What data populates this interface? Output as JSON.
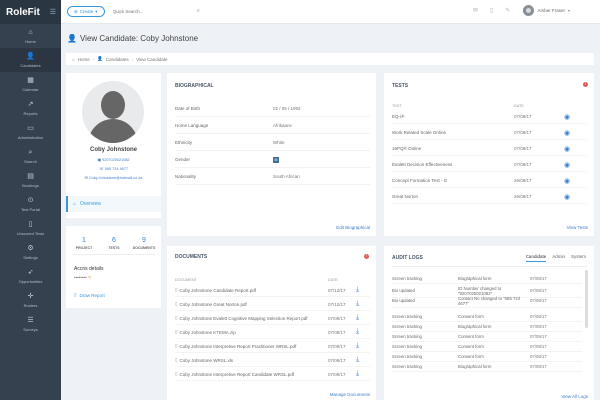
{
  "app": {
    "brand": "RoleFit"
  },
  "sidebar": {
    "items": [
      {
        "label": "Home",
        "icon": "home-icon",
        "glyph": "⌂"
      },
      {
        "label": "Candidates",
        "icon": "user-icon",
        "glyph": "👤"
      },
      {
        "label": "Calendar",
        "icon": "calendar-icon",
        "glyph": "▦"
      },
      {
        "label": "Reports",
        "icon": "chart-icon",
        "glyph": "↗"
      },
      {
        "label": "Administration",
        "icon": "monitor-icon",
        "glyph": "▭"
      },
      {
        "label": "Search",
        "icon": "search-icon",
        "glyph": "⌕"
      },
      {
        "label": "Bookings",
        "icon": "briefcase-icon",
        "glyph": "▤"
      },
      {
        "label": "Test Portal",
        "icon": "link-icon",
        "glyph": "⊙"
      },
      {
        "label": "Unscored Tests",
        "icon": "document-icon",
        "glyph": "▯"
      },
      {
        "label": "Settings",
        "icon": "gear-icon",
        "glyph": "⚙"
      },
      {
        "label": "Opportunities",
        "icon": "rocket-icon",
        "glyph": "➶"
      },
      {
        "label": "Rosters",
        "icon": "move-icon",
        "glyph": "✛"
      },
      {
        "label": "Surveys",
        "icon": "list-icon",
        "glyph": "☰"
      }
    ]
  },
  "topbar": {
    "create_label": "Create",
    "search_placeholder": "Quick Search...",
    "user_name": "Amber Fraser"
  },
  "page": {
    "title": "View Candidate: Coby Johnstone",
    "breadcrumb": [
      "Home",
      "Candidates",
      "View Candidate"
    ]
  },
  "profile": {
    "name": "Coby Johnstone",
    "id_number": "9207025021082",
    "phone": "085 724 4677",
    "email": "Coby.Johnstone@hotmail.co.za",
    "overview_label": "Overview"
  },
  "stats": {
    "items": [
      {
        "num": "1",
        "label": "PROJECT"
      },
      {
        "num": "6",
        "label": "TESTS"
      },
      {
        "num": "9",
        "label": "DOCUMENTS"
      }
    ],
    "accns_title": "Accns details",
    "accns_value": "••••••••",
    "draw_report": "Draw Report"
  },
  "bio": {
    "title": "BIOGRAPHICAL",
    "rows": [
      {
        "k": "Date of Birth",
        "v": "02 / 06 / 1992"
      },
      {
        "k": "Home Language",
        "v": "Afrikaans"
      },
      {
        "k": "Ethnicity",
        "v": "White"
      },
      {
        "k": "Gender",
        "v": "M"
      },
      {
        "k": "Nationality",
        "v": "South African"
      }
    ],
    "edit_label": "Edit Biographical"
  },
  "tests": {
    "title": "TESTS",
    "alert_count": "!",
    "col_test": "TEST",
    "col_date": "DATE",
    "rows": [
      {
        "name": "EQ-i®",
        "date": "07/09/17"
      },
      {
        "name": "Work Related Scale Online",
        "date": "07/09/17"
      },
      {
        "name": "16PQ® Online",
        "date": "07/09/17"
      },
      {
        "name": "Evalett Decision Effectiveness",
        "date": "07/09/17"
      },
      {
        "name": "Concept Formation Test - G",
        "date": "26/09/17"
      },
      {
        "name": "Great Norton",
        "date": "26/09/17"
      }
    ],
    "view_label": "View Tests"
  },
  "documents": {
    "title": "DOCUMENTS",
    "alert_count": "!",
    "col_doc": "DOCUMENT",
    "col_date": "DATE",
    "rows": [
      {
        "name": "Coby Johnstone Candidate Report.pdf",
        "date": "07/12/17"
      },
      {
        "name": "Coby Johnstone Great Norton.pdf",
        "date": "07/12/17"
      },
      {
        "name": "Coby Johnstone Evalett Cognitive Mapping Selection Report.pdf",
        "date": "07/09/17"
      },
      {
        "name": "Coby Johnstone KTEMA.zip",
        "date": "07/09/17"
      },
      {
        "name": "Coby Johnstone Interpretive Report Practitioner WRSL.pdf",
        "date": "07/09/17"
      },
      {
        "name": "Coby Johnstone WRSL.xls",
        "date": "07/09/17"
      },
      {
        "name": "Coby Johnstone Interpretive Report Candidate WRSL.pdf",
        "date": "07/09/17"
      }
    ],
    "manage_label": "Manage Documents"
  },
  "audit": {
    "title": "AUDIT LOGS",
    "tabs": [
      "Candidate",
      "Admin",
      "System"
    ],
    "rows": [
      {
        "a": "Screen tracking",
        "b": "Biographical form",
        "c": "07/09/17"
      },
      {
        "a": "Bio updated",
        "b": "ID Number changed to \"9207025021082\"",
        "c": "07/09/17"
      },
      {
        "a": "Bio updated",
        "b": "Contact No changed to \"085 724 4677\"",
        "c": "07/09/17"
      },
      {
        "a": "Screen tracking",
        "b": "Consent form",
        "c": "07/09/17"
      },
      {
        "a": "Screen tracking",
        "b": "Biographical form",
        "c": "07/09/17"
      },
      {
        "a": "Screen tracking",
        "b": "Consent form",
        "c": "07/09/17"
      },
      {
        "a": "Screen tracking",
        "b": "Consent form",
        "c": "07/09/17"
      },
      {
        "a": "Screen tracking",
        "b": "Consent form",
        "c": "07/09/17"
      },
      {
        "a": "Screen tracking",
        "b": "Biographical form",
        "c": "07/09/17"
      }
    ],
    "view_label": "View All Logs"
  },
  "colors": {
    "accent": "#3598dc",
    "sidebar": "#364150",
    "alert": "#e35b5a"
  }
}
